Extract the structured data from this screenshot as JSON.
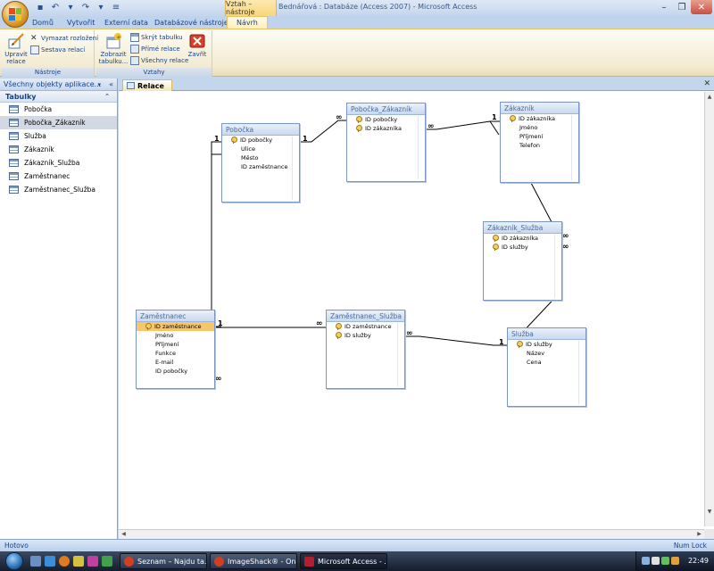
{
  "window": {
    "context_tab_title": "Vztah – nástroje",
    "title": "Bednářová : Databáze (Access 2007) - Microsoft Access"
  },
  "ribbon_tabs": [
    "Domů",
    "Vytvořit",
    "Externí data",
    "Databázové nástroje",
    "Návrh"
  ],
  "ribbon": {
    "tools": {
      "label": "Nástroje",
      "edit_relations": "Upravit relace",
      "clear_layout": "Vymazat rozložení",
      "relation_report": "Sestava relací"
    },
    "relations": {
      "label": "Vztahy",
      "show_table": "Zobrazit tabulku...",
      "hide_table": "Skrýt tabulku",
      "direct_relations": "Přímé relace",
      "all_relations": "Všechny relace",
      "close": "Zavřít"
    }
  },
  "nav": {
    "header": "Všechny objekty aplikace...",
    "group": "Tabulky",
    "items": [
      "Pobočka",
      "Pobočka_Zákazník",
      "Služba",
      "Zákazník",
      "Zákazník_Služba",
      "Zaměstnanec",
      "Zaměstnanec_Služba"
    ],
    "selected_index": 1
  },
  "doc_tab": "Relace",
  "tables": {
    "pobocka": {
      "title": "Pobočka",
      "fields": [
        "ID pobočky",
        "Ulice",
        "Město",
        "ID zaměstnance"
      ]
    },
    "pobocka_zakaznik": {
      "title": "Pobočka_Zákazník",
      "fields": [
        "ID pobočky",
        "ID zákazníka"
      ]
    },
    "zakaznik": {
      "title": "Zákazník",
      "fields": [
        "ID zákazníka",
        "Jméno",
        "Příjmení",
        "Telefon"
      ]
    },
    "zakaznik_sluzba": {
      "title": "Zákazník_Služba",
      "fields": [
        "ID zákazníka",
        "ID služby"
      ]
    },
    "zamestnanec": {
      "title": "Zaměstnanec",
      "fields": [
        "ID zaměstnance",
        "Jméno",
        "Příjmení",
        "Funkce",
        "E-mail",
        "ID pobočky"
      ]
    },
    "zamestnanec_sluzba": {
      "title": "Zaměstnanec_Služba",
      "fields": [
        "ID zaměstnance",
        "ID služby"
      ]
    },
    "sluzba": {
      "title": "Služba",
      "fields": [
        "ID služby",
        "Název",
        "Cena"
      ]
    }
  },
  "relation_labels": {
    "one": "1",
    "many": "∞"
  },
  "status": {
    "left": "Hotovo",
    "right": "Num Lock"
  },
  "taskbar": {
    "tasks": [
      "Seznam – Najdu ta...",
      "ImageShack® - Onl...",
      "Microsoft Access - ..."
    ],
    "clock": "22:49"
  },
  "colors": {
    "accent": "#15428b",
    "selected_field": "#f7c56a",
    "ribbon_context": "#f7d77a"
  }
}
